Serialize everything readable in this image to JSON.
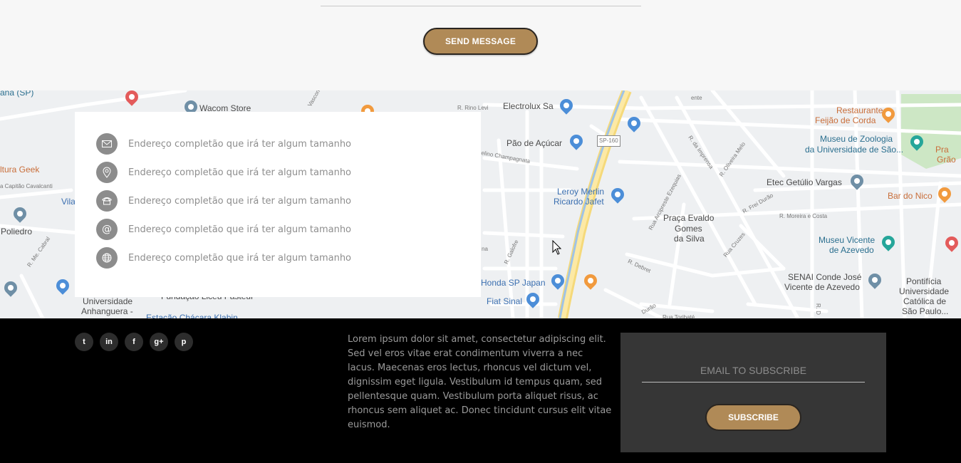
{
  "contact_form": {
    "send_label": "SEND MESSAGE"
  },
  "map": {
    "labels": {
      "wacom": "Wacom Store",
      "electrolux": "Electrolux Sa",
      "pao": "Pão de Açúcar",
      "leroy1": "Leroy Merlin",
      "leroy2": "Ricardo Jafet",
      "restaurante1": "Restaurante",
      "restaurante2": "Feijão de Corda",
      "museu_zoo1": "Museu de Zoologia",
      "museu_zoo2": "da Universidade de São...",
      "etec": "Etec Getúlio Vargas",
      "bar_nico": "Bar do Nico",
      "praca1": "Praça Evaldo",
      "praca2": "Gomes",
      "praca3": "da Silva",
      "museu_vicente1": "Museu Vicente",
      "museu_vicente2": "de Azevedo",
      "senai1": "SENAI Conde José",
      "senai2": "Vicente de Azevedo",
      "pontificia1": "Pontifícia",
      "pontificia2": "Universidade",
      "pontificia3": "Católica de",
      "pontificia4": "São Paulo...",
      "honda": "Honda SP Japan",
      "fiat": "Fiat Sinal",
      "poliedro": "Poliedro",
      "cultura": "ltura Geek",
      "anhanguera1": "Universidade",
      "anhanguera2": "Anhanguera -",
      "sp160": "SP-160",
      "rino": "R. Rino Levi",
      "sp": "ana (SP)",
      "vila": "Vila",
      "pra": "Pra",
      "grao": "Grão",
      "fundacao": "Fundação Liceu Pasteur",
      "estacao": "Estação Chácara Klabin",
      "capitao": "a Capitão Cavalcanti",
      "champagnata": "elino Champagnata",
      "imprensa": "R. da Imprensa",
      "oliveira": "R. Oliveira Melo",
      "frei": "R. Frei Durão",
      "moreira": "R. Moreira e Costa",
      "arcipreste": "Rua Arcipreste Ezequias",
      "cruzes": "Rua Cruzes",
      "debret": "R. Debret",
      "galofre": "R. Galofre",
      "tonbate": "Rua Toribaté",
      "durao": "Durão",
      "cabral": "R. Me. Cabral",
      "vascon": "Vascon",
      "ente": "ente",
      "na": "na",
      "rd": "R. D"
    }
  },
  "contact_info": [
    {
      "icon": "envelope-icon",
      "text": "Endereço completão que irá ter algum tamanho"
    },
    {
      "icon": "map-pin-icon",
      "text": "Endereço completão que irá ter algum tamanho"
    },
    {
      "icon": "phone-icon",
      "text": "Endereço completão que irá ter algum tamanho"
    },
    {
      "icon": "at-icon",
      "text": "Endereço completão que irá ter algum tamanho"
    },
    {
      "icon": "globe-icon",
      "text": "Endereço completão que irá ter algum tamanho"
    }
  ],
  "footer": {
    "socials": [
      {
        "name": "twitter-icon",
        "glyph": "t"
      },
      {
        "name": "linkedin-icon",
        "glyph": "in"
      },
      {
        "name": "facebook-icon",
        "glyph": "f"
      },
      {
        "name": "google-plus-icon",
        "glyph": "g+"
      },
      {
        "name": "pinterest-icon",
        "glyph": "p"
      }
    ],
    "about_text": "Lorem ipsum dolor sit amet, consectetur adipiscing elit. Sed vel eros vitae erat condimentum viverra a nec lacus. Maecenas eros lectus, rhoncus vel dictum vel, dignissim eget ligula. Vestibulum id tempus quam, sed pellentesque quam. Vestibulum porta aliquet risus, ac rhoncus sem aliquet ac. Donec tincidunt cursus elit vitae euismod.",
    "subscribe": {
      "placeholder": "EMAIL TO SUBSCRIBE",
      "button_label": "SUBSCRIBE"
    }
  },
  "colors": {
    "accent": "#b08a57",
    "footer_bg": "#000000",
    "subscribe_bg": "#363636",
    "icon_bg": "#8c8c8c",
    "map_road_yellow": "#f8e08e"
  }
}
